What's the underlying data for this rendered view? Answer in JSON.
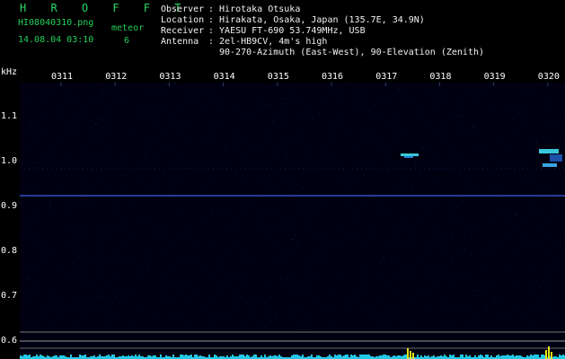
{
  "app": {
    "brand": "H R O F F T"
  },
  "file": {
    "name": "HI08040310.png",
    "datetime": "14.08.04 03:10",
    "mode_label": "meteor",
    "meteor_count": "6"
  },
  "station": {
    "observer_key": "Observer",
    "observer_val": ": Hirotaka Otsuka",
    "location_key": "Location",
    "location_val": ": Hirakata, Osaka, Japan (135.7E, 34.9N)",
    "receiver_key": "Receiver",
    "receiver_val": ": YAESU FT-690 53.749MHz, USB",
    "antenna_key": "Antenna",
    "antenna_val": ": 2el-HB9CV, 4m's high",
    "antenna_val2": "90-270-Azimuth (East-West), 90-Elevation (Zenith)"
  },
  "axes": {
    "y_unit": "kHz",
    "x_ticks": [
      "0311",
      "0312",
      "0313",
      "0314",
      "0315",
      "0316",
      "0317",
      "0318",
      "0319",
      "0320"
    ],
    "y_ticks": [
      "1.1",
      "1.0",
      "0.9",
      "0.8",
      "0.7",
      "0.6"
    ]
  },
  "colors": {
    "background": "#000000",
    "plot_bg": "#000010",
    "carrier_line": "#2f52c8",
    "echo": "#39c7d9",
    "noise_bar": "#22c7e6",
    "burst": "#e6e617",
    "brand_green": "#2bd765"
  }
}
